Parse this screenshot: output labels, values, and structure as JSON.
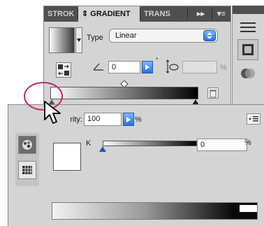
{
  "gradient_panel": {
    "tabs": [
      {
        "label": "STROK",
        "active": false
      },
      {
        "label": "⇕ GRADIENT",
        "active": true
      },
      {
        "label": "TRANS",
        "active": false
      }
    ],
    "tab_controls": {
      "collapse": "▸▸",
      "menu": "▾≡"
    },
    "type_label": "Type",
    "type_value": "Linear",
    "angle_value": "0",
    "degree_symbol": "°",
    "aspect_value": "",
    "aspect_unit": "%",
    "gradient_start_color": "#ffffff",
    "gradient_end_color": "#000000"
  },
  "color_panel": {
    "opacity_label": "rity:",
    "opacity_value": "100",
    "opacity_unit": "%",
    "channel_label": "K",
    "channel_value": "0",
    "channel_unit": "%",
    "swatch_color": "#ffffff"
  },
  "colors": {
    "accent_blue": "#2a6fd9",
    "highlight_ring": "#c12a6a",
    "panel_bg": "#d4d4d4",
    "tab_bar": "#4f4f4f"
  },
  "icons": [
    "chevron-up-down-icon",
    "collapse-icon",
    "panel-menu-icon",
    "reverse-gradient-icon",
    "angle-icon",
    "aspect-ratio-icon",
    "trash-icon",
    "gradient-stop-icon",
    "color-picker-icon",
    "swatches-grid-icon",
    "arrow-cursor-icon",
    "hamburger-icon",
    "square-panel-icon",
    "overlap-circles-icon"
  ]
}
